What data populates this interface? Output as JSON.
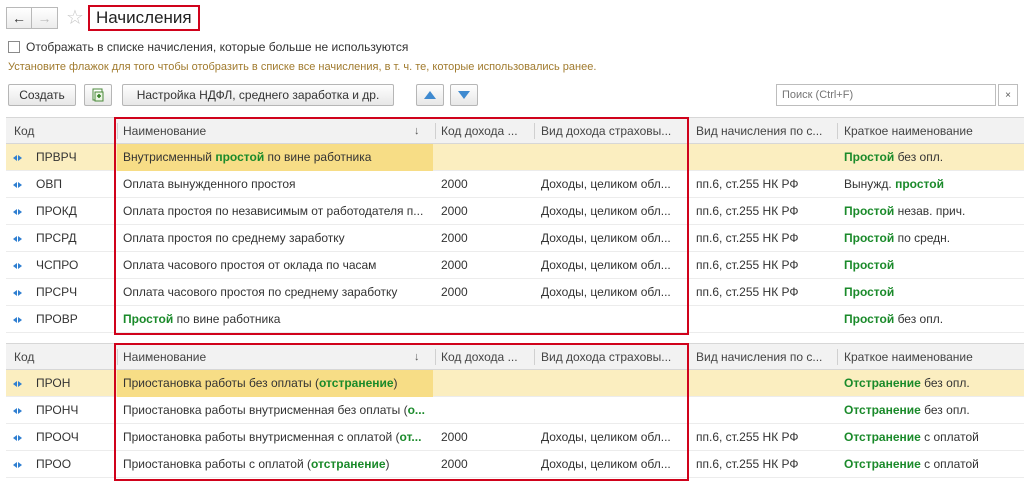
{
  "nav": {
    "back": "←",
    "forward": "→"
  },
  "title": "Начисления",
  "checkbox_label": "Отображать в списке начисления, которые больше не используются",
  "hint": "Установите флажок для того чтобы отобразить в списке все начисления, в т. ч. те, которые использовались ранее.",
  "toolbar": {
    "create": "Создать",
    "settings": "Настройка НДФЛ, среднего заработка и др.",
    "search_placeholder": "Поиск (Ctrl+F)",
    "clear": "×"
  },
  "columns": [
    "Код",
    "Наименование",
    "Код дохода ...",
    "Вид дохода страховы...",
    "Вид начисления по с...",
    "Краткое наименование"
  ],
  "sort_indicator": "↓",
  "table1": [
    {
      "code": "ПРВРЧ",
      "name": [
        "Внутрисменный ",
        "простой",
        " по вине работника"
      ],
      "inc": "",
      "kind": "",
      "vid": "",
      "short": [
        "Простой",
        " без опл."
      ],
      "selected": true
    },
    {
      "code": "ОВП",
      "name": [
        "Оплата вынужденного простоя",
        "",
        ""
      ],
      "inc": "2000",
      "kind": "Доходы, целиком обл...",
      "vid": "пп.6, ст.255 НК РФ",
      "short": [
        "",
        "Вынужд. ",
        "простой"
      ]
    },
    {
      "code": "ПРОКД",
      "name": [
        "Оплата простоя по независимым от работодателя п...",
        "",
        ""
      ],
      "inc": "2000",
      "kind": "Доходы, целиком обл...",
      "vid": "пп.6, ст.255 НК РФ",
      "short": [
        "Простой",
        " незав. прич."
      ]
    },
    {
      "code": "ПРСРД",
      "name": [
        "Оплата простоя по среднему заработку",
        "",
        ""
      ],
      "inc": "2000",
      "kind": "Доходы, целиком обл...",
      "vid": "пп.6, ст.255 НК РФ",
      "short": [
        "Простой",
        " по средн."
      ]
    },
    {
      "code": "ЧСПРО",
      "name": [
        "Оплата часового простоя от оклада по часам",
        "",
        ""
      ],
      "inc": "2000",
      "kind": "Доходы, целиком обл...",
      "vid": "пп.6, ст.255 НК РФ",
      "short": [
        "Простой",
        ""
      ]
    },
    {
      "code": "ПРСРЧ",
      "name": [
        "Оплата часового простоя по среднему заработку",
        "",
        ""
      ],
      "inc": "2000",
      "kind": "Доходы, целиком обл...",
      "vid": "пп.6, ст.255 НК РФ",
      "short": [
        "Простой",
        ""
      ]
    },
    {
      "code": "ПРОВР",
      "name": [
        "",
        "Простой",
        " по вине работника"
      ],
      "inc": "",
      "kind": "",
      "vid": "",
      "short": [
        "Простой",
        " без опл."
      ]
    }
  ],
  "table2": [
    {
      "code": "ПРОН",
      "name": [
        "Приостановка работы без оплаты (",
        "отстранение",
        ")"
      ],
      "inc": "",
      "kind": "",
      "vid": "",
      "short": [
        "Отстранение",
        " без опл."
      ],
      "selected": true
    },
    {
      "code": "ПРОНЧ",
      "name": [
        "Приостановка работы внутрисменная без оплаты (",
        "о...",
        ""
      ],
      "inc": "",
      "kind": "",
      "vid": "",
      "short": [
        "Отстранение",
        " без опл."
      ]
    },
    {
      "code": "ПРООЧ",
      "name": [
        "Приостановка работы внутрисменная с оплатой (",
        "от...",
        ""
      ],
      "inc": "2000",
      "kind": "Доходы, целиком обл...",
      "vid": "пп.6, ст.255 НК РФ",
      "short": [
        "Отстранение",
        " с оплатой"
      ]
    },
    {
      "code": "ПРОО",
      "name": [
        "Приостановка работы с оплатой (",
        "отстранение",
        ")"
      ],
      "inc": "2000",
      "kind": "Доходы, целиком обл...",
      "vid": "пп.6, ст.255 НК РФ",
      "short": [
        "Отстранение",
        " с оплатой"
      ]
    }
  ],
  "colors": {
    "highlight": "#1a8a2a",
    "selected_row": "#fbeec0",
    "frame": "#d0021b",
    "accent": "#3f8ad0"
  }
}
